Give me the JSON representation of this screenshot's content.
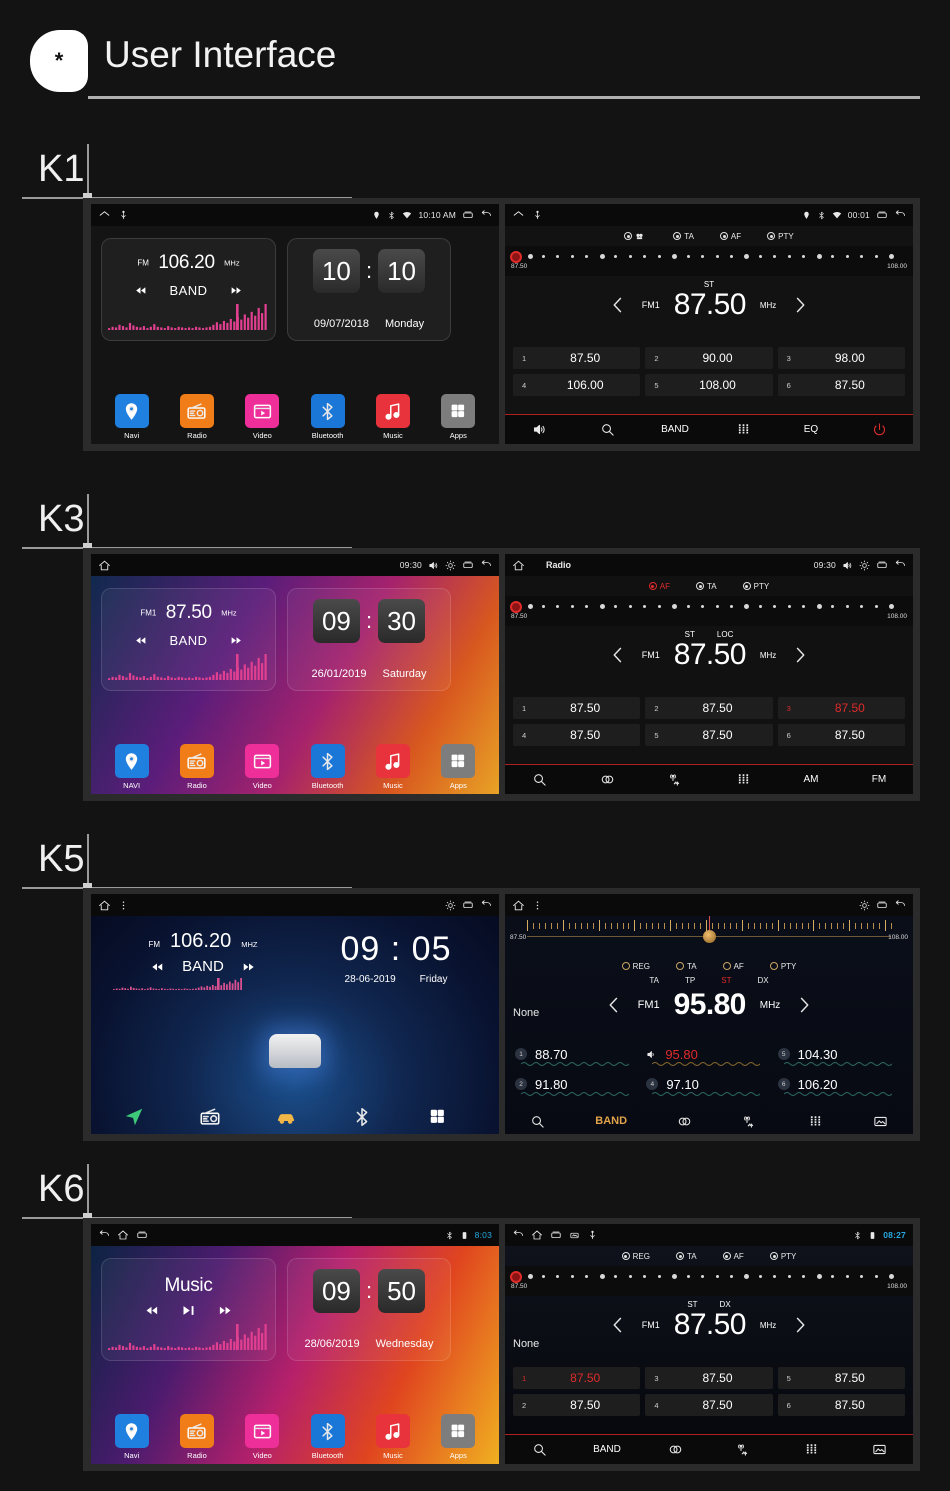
{
  "header": {
    "badge_glyph": "*",
    "title": "User Interface"
  },
  "sections": [
    {
      "label": "K1",
      "home": {
        "statusbar": {
          "home_icon": "home-icon",
          "usb_icon": "usb-icon",
          "location_icon": "location-icon",
          "bluetooth_icon": "bluetooth-icon",
          "wifi_icon": "wifi-icon",
          "time": "10:10 AM",
          "recents_icon": "recents-icon",
          "back_icon": "back-icon"
        },
        "radio_widget": {
          "band_label": "FM",
          "frequency": "106.20",
          "unit": "MHz",
          "prev_label": "prev-track",
          "band_button": "BAND",
          "next_label": "next-track"
        },
        "clock_widget": {
          "hours": "10",
          "separator": ":",
          "minutes": "10",
          "date": "09/07/2018",
          "weekday": "Monday"
        },
        "dock": [
          {
            "label": "Navi",
            "icon": "navi-pin-icon",
            "color": "#2080e0"
          },
          {
            "label": "Radio",
            "icon": "radio-icon",
            "color": "#f07d18"
          },
          {
            "label": "Video",
            "icon": "video-play-icon",
            "color": "#ee2f9a"
          },
          {
            "label": "Bluetooth",
            "icon": "bluetooth-icon",
            "color": "#1a77d8"
          },
          {
            "label": "Music",
            "icon": "music-note-icon",
            "color": "#e8333c"
          },
          {
            "label": "Apps",
            "icon": "apps-grid-icon",
            "color": "#7d7d7d"
          }
        ]
      },
      "radio": {
        "statusbar": {
          "home_icon": "home-icon",
          "usb_icon": "usb-icon",
          "location_icon": "location-icon",
          "bluetooth_icon": "bluetooth-icon",
          "wifi_icon": "wifi-icon",
          "time": "00:01",
          "recents_icon": "recents-icon",
          "back_icon": "back-icon"
        },
        "rds": [
          {
            "label": "",
            "icon": "reg-icon",
            "state": "on"
          },
          {
            "label": "TA",
            "state": "on"
          },
          {
            "label": "AF",
            "state": "on"
          },
          {
            "label": "PTY",
            "state": "on"
          }
        ],
        "tuner": {
          "min": "87.50",
          "max": "108.00"
        },
        "flags": [
          {
            "text": "ST",
            "color": "white"
          }
        ],
        "band": "FM1",
        "frequency": "87.50",
        "unit": "MHz",
        "prev_icon": "chevron-left-icon",
        "next_icon": "chevron-right-icon",
        "presets": [
          {
            "index": "1",
            "value": "87.50",
            "active": false
          },
          {
            "index": "2",
            "value": "90.00",
            "active": false
          },
          {
            "index": "3",
            "value": "98.00",
            "active": false
          },
          {
            "index": "4",
            "value": "106.00",
            "active": false
          },
          {
            "index": "5",
            "value": "108.00",
            "active": false
          },
          {
            "index": "6",
            "value": "87.50",
            "active": false
          }
        ],
        "bottom_bar": [
          {
            "name": "volume-icon",
            "label": ""
          },
          {
            "name": "search-icon",
            "label": ""
          },
          {
            "name": "band-button",
            "label": "BAND"
          },
          {
            "name": "keypad-icon",
            "label": ""
          },
          {
            "name": "eq-button",
            "label": "EQ"
          },
          {
            "name": "power-icon",
            "label": ""
          }
        ]
      }
    },
    {
      "label": "K3",
      "home": {
        "statusbar": {
          "home_icon": "home-icon",
          "time": "09:30",
          "volume_icon": "volume-icon",
          "brightness_icon": "brightness-icon",
          "recents_icon": "recents-icon",
          "back_icon": "back-icon"
        },
        "radio_widget": {
          "band_label": "FM1",
          "frequency": "87.50",
          "unit": "MHz",
          "band_button": "BAND"
        },
        "clock_widget": {
          "hours": "09",
          "separator": ":",
          "minutes": "30",
          "date": "26/01/2019",
          "weekday": "Saturday"
        },
        "dock": [
          {
            "label": "NAVI",
            "icon": "navi-pin-icon",
            "color": "#2080e0"
          },
          {
            "label": "Radio",
            "icon": "radio-icon",
            "color": "#f07d18"
          },
          {
            "label": "Video",
            "icon": "video-play-icon",
            "color": "#ee2f9a"
          },
          {
            "label": "Bluetooth",
            "icon": "bluetooth-icon",
            "color": "#1a77d8"
          },
          {
            "label": "Music",
            "icon": "music-note-icon",
            "color": "#e8333c"
          },
          {
            "label": "Apps",
            "icon": "apps-grid-icon",
            "color": "#7d7d7d"
          }
        ]
      },
      "radio": {
        "statusbar": {
          "home_icon": "home-icon",
          "title": "Radio",
          "time": "09:30",
          "volume_icon": "volume-icon",
          "brightness_icon": "brightness-icon",
          "recents_icon": "recents-icon",
          "back_icon": "back-icon"
        },
        "rds": [
          {
            "label": "AF",
            "state": "active"
          },
          {
            "label": "TA",
            "state": "on"
          },
          {
            "label": "PTY",
            "state": "on"
          }
        ],
        "tuner": {
          "min": "87.50",
          "max": "108.00"
        },
        "flags": [
          {
            "text": "ST"
          },
          {
            "text": "LOC"
          }
        ],
        "band": "FM1",
        "frequency": "87.50",
        "unit": "MHz",
        "presets": [
          {
            "index": "1",
            "value": "87.50",
            "active": false
          },
          {
            "index": "2",
            "value": "87.50",
            "active": false
          },
          {
            "index": "3",
            "value": "87.50",
            "active": true
          },
          {
            "index": "4",
            "value": "87.50",
            "active": false
          },
          {
            "index": "5",
            "value": "87.50",
            "active": false
          },
          {
            "index": "6",
            "value": "87.50",
            "active": false
          }
        ],
        "bottom_bar": [
          {
            "name": "search-icon",
            "label": ""
          },
          {
            "name": "stereo-icon",
            "label": ""
          },
          {
            "name": "dx-loc-icon",
            "label": ""
          },
          {
            "name": "keypad-icon",
            "label": ""
          },
          {
            "name": "am-button",
            "label": "AM"
          },
          {
            "name": "fm-button",
            "label": "FM"
          }
        ]
      }
    },
    {
      "label": "K5",
      "home": {
        "statusbar": {
          "home_icon": "home-icon",
          "menu_icon": "overflow-menu-icon",
          "brightness_icon": "brightness-icon",
          "recents_icon": "recents-icon",
          "back_icon": "back-icon"
        },
        "radio_widget": {
          "band_label": "FM",
          "frequency": "106.20",
          "unit": "MHZ",
          "band_button": "BAND"
        },
        "clock_widget": {
          "hours": "09",
          "separator": ":",
          "minutes": "05",
          "date": "28-06-2019",
          "weekday": "Friday"
        },
        "dock": [
          {
            "label": "",
            "icon": "navigation-arrow-icon",
            "color": "#3ec97a"
          },
          {
            "label": "",
            "icon": "radio-icon",
            "color": "#9fe6c8"
          },
          {
            "label": "",
            "icon": "car-icon",
            "color": "#f0b648"
          },
          {
            "label": "",
            "icon": "bluetooth-icon",
            "color": "#2b8ce8"
          },
          {
            "label": "",
            "icon": "apps-grid-icon",
            "color": "#e8404f"
          }
        ]
      },
      "radio": {
        "statusbar": {
          "home_icon": "home-icon",
          "menu_icon": "overflow-menu-icon",
          "brightness_icon": "brightness-icon",
          "recents_icon": "recents-icon",
          "back_icon": "back-icon"
        },
        "tuner": {
          "min": "87.50",
          "max": "108.00"
        },
        "rds": [
          {
            "label": "REG",
            "state": "off"
          },
          {
            "label": "TA",
            "state": "off"
          },
          {
            "label": "AF",
            "state": "off"
          },
          {
            "label": "PTY",
            "state": "off"
          }
        ],
        "flags": [
          {
            "text": "TA",
            "color": "white"
          },
          {
            "text": "TP",
            "color": "white"
          },
          {
            "text": "ST",
            "color": "red"
          },
          {
            "text": "DX",
            "color": "white"
          }
        ],
        "station_name": "None",
        "band": "FM1",
        "frequency": "95.80",
        "unit": "MHz",
        "presets": [
          {
            "index": "1",
            "value": "88.70",
            "active": false
          },
          {
            "index": "2",
            "value": "91.80",
            "active": false
          },
          {
            "index": "3",
            "value": "95.80",
            "active": true,
            "icon": "speaker-icon"
          },
          {
            "index": "4",
            "value": "97.10",
            "active": false
          },
          {
            "index": "5",
            "value": "104.30",
            "active": false
          },
          {
            "index": "6",
            "value": "106.20",
            "active": false
          }
        ],
        "bottom_bar": [
          {
            "name": "search-icon",
            "label": ""
          },
          {
            "name": "band-button",
            "label": "BAND"
          },
          {
            "name": "stereo-icon",
            "label": ""
          },
          {
            "name": "dx-loc-icon",
            "label": ""
          },
          {
            "name": "keypad-icon",
            "label": ""
          },
          {
            "name": "photo-icon",
            "label": ""
          }
        ]
      }
    },
    {
      "label": "K6",
      "home": {
        "statusbar": {
          "back_icon": "back-icon",
          "home_icon": "home-icon",
          "recents_icon": "recents-icon",
          "bluetooth_icon": "bluetooth-icon",
          "battery_icon": "battery-icon",
          "time": "8:03"
        },
        "media_widget": {
          "title": "Music",
          "prev_icon": "previous-icon",
          "play_icon": "play-pause-icon",
          "next_icon": "next-icon"
        },
        "clock_widget": {
          "hours": "09",
          "separator": ":",
          "minutes": "50",
          "date": "28/06/2019",
          "weekday": "Wednesday"
        },
        "dock": [
          {
            "label": "Navi",
            "icon": "navi-pin-icon",
            "color": "#2080e0"
          },
          {
            "label": "Radio",
            "icon": "radio-icon",
            "color": "#f07d18"
          },
          {
            "label": "Video",
            "icon": "video-play-icon",
            "color": "#ee2f9a"
          },
          {
            "label": "Bluetooth",
            "icon": "bluetooth-icon",
            "color": "#1a77d8"
          },
          {
            "label": "Music",
            "icon": "music-note-icon",
            "color": "#e8333c"
          },
          {
            "label": "Apps",
            "icon": "apps-grid-icon",
            "color": "#7d7d7d"
          }
        ]
      },
      "radio": {
        "statusbar": {
          "back_icon": "back-icon",
          "home_icon": "home-icon",
          "recents_icon": "recents-icon",
          "screenshot_icon": "screenshot-icon",
          "usb_icon": "usb-icon",
          "bluetooth_icon": "bluetooth-icon",
          "battery_icon": "battery-icon",
          "time": "08:27"
        },
        "rds": [
          {
            "label": "REG",
            "state": "on"
          },
          {
            "label": "TA",
            "state": "on"
          },
          {
            "label": "AF",
            "state": "on"
          },
          {
            "label": "PTY",
            "state": "on"
          }
        ],
        "tuner": {
          "min": "87.50",
          "max": "108.00"
        },
        "flags": [
          {
            "text": "ST"
          },
          {
            "text": "DX"
          }
        ],
        "station_name": "None",
        "band": "FM1",
        "frequency": "87.50",
        "unit": "MHz",
        "presets": [
          {
            "index": "1",
            "value": "87.50",
            "active": true
          },
          {
            "index": "3",
            "value": "87.50",
            "active": false
          },
          {
            "index": "5",
            "value": "87.50",
            "active": false
          },
          {
            "index": "2",
            "value": "87.50",
            "active": false
          },
          {
            "index": "4",
            "value": "87.50",
            "active": false
          },
          {
            "index": "6",
            "value": "87.50",
            "active": false
          }
        ],
        "bottom_bar": [
          {
            "name": "search-icon",
            "label": ""
          },
          {
            "name": "band-button",
            "label": "BAND"
          },
          {
            "name": "stereo-icon",
            "label": ""
          },
          {
            "name": "dx-loc-icon",
            "label": ""
          },
          {
            "name": "keypad-icon",
            "label": ""
          },
          {
            "name": "photo-icon",
            "label": ""
          }
        ]
      }
    }
  ],
  "colors": {
    "page_bg": "#131313",
    "accent_red": "#e02b2b",
    "accent_amber": "#d79a4a",
    "rule": "#b0b0b0"
  }
}
